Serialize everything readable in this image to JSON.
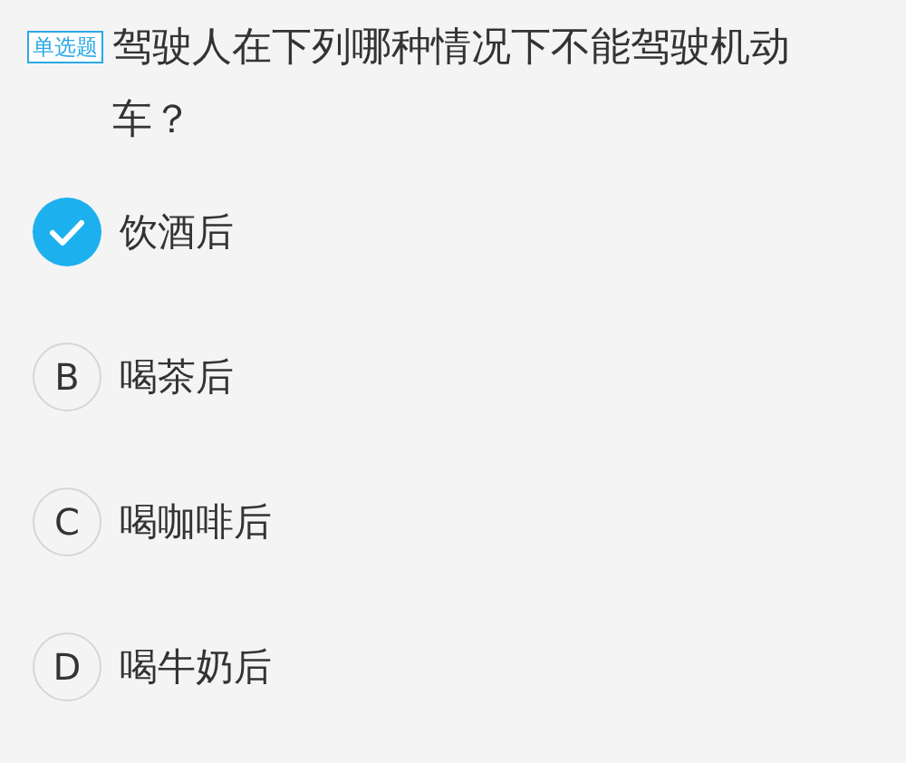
{
  "question": {
    "type_badge": "单选题",
    "text": "驾驶人在下列哪种情况下不能驾驶机动车？"
  },
  "options": [
    {
      "text": "饮酒后",
      "selected": true
    },
    {
      "letter": "B",
      "text": "喝茶后",
      "selected": false
    },
    {
      "letter": "C",
      "text": "喝咖啡后",
      "selected": false
    },
    {
      "letter": "D",
      "text": "喝牛奶后",
      "selected": false
    }
  ]
}
